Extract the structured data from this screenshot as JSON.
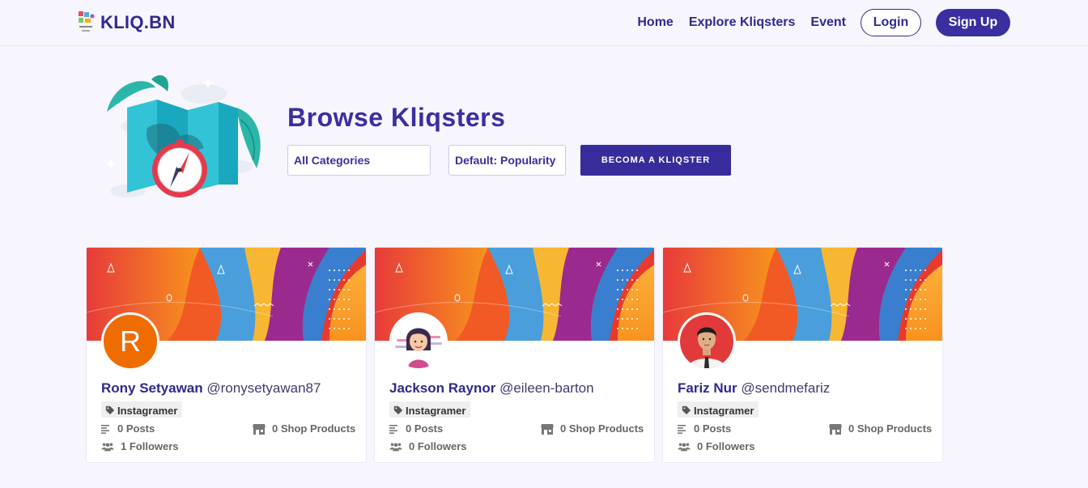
{
  "navbar": {
    "brand": "KLIQ.BN",
    "links": [
      "Home",
      "Explore Kliqsters",
      "Event"
    ],
    "login": "Login",
    "signup": "Sign Up"
  },
  "hero": {
    "title": "Browse Kliqsters",
    "category_select": "All Categories",
    "sort_select": "Default: Popularity",
    "become_button": "BECOMA A KLIQSTER"
  },
  "colors": {
    "primary": "#3a2fa0",
    "avatar_orange": "#ef6c00"
  },
  "cards": [
    {
      "name": "Rony Setyawan",
      "handle": "@ronysetyawan87",
      "tag": "Instagramer",
      "posts": "0 Posts",
      "products": "0 Shop Products",
      "followers": "1 Followers",
      "avatar": "R"
    },
    {
      "name": "Jackson Raynor",
      "handle": "@eileen-barton",
      "tag": "Instagramer",
      "posts": "0 Posts",
      "products": "0 Shop Products",
      "followers": "0 Followers",
      "avatar": ""
    },
    {
      "name": "Fariz Nur",
      "handle": "@sendmefariz",
      "tag": "Instagramer",
      "posts": "0 Posts",
      "products": "0 Shop Products",
      "followers": "0 Followers",
      "avatar": ""
    }
  ]
}
